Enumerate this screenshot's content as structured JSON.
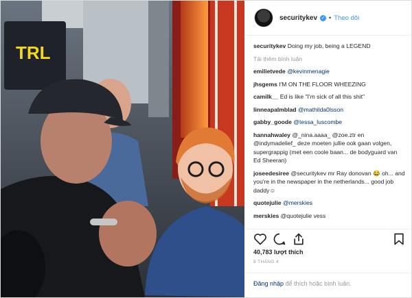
{
  "post": {
    "username": "securitykev",
    "follow_label": "Theo dõi",
    "dot": "•",
    "verified_mark": "✓",
    "caption": {
      "user": "securitykev",
      "text": "Doing my job, being a LEGEND"
    },
    "load_more": "Tải thêm bình luận",
    "comments": [
      {
        "user": "emilietvede",
        "text": "@kevinmenagie"
      },
      {
        "user": "jhsgems",
        "text": "I'M ON THE FLOOR WHEEZING"
      },
      {
        "user": "camilk__",
        "text": "Ed is like \"I'm sick of all this shit\""
      },
      {
        "user": "linneapalmblad",
        "text": "@mathilda0lsson"
      },
      {
        "user": "gabby_goode",
        "text": "@tessa_luscombe"
      },
      {
        "user": "hannahwaley",
        "text": "@_nina.aaaa_ @zoe.ztr en @indymadelief_ deze moeten jullie ook gaan volgen, supergrappig (met een coole baan... de bodyguard van Ed Sheeran)"
      },
      {
        "user": "joseedesiree",
        "text": "@securitykev mr Ray donovan 😂 oh... and you're in the newspaper in the netherlands... good job daddy☺"
      },
      {
        "user": "quotejulie",
        "text": "@merskies"
      },
      {
        "user": "merskies",
        "text": "@quotejulie vess"
      }
    ],
    "likes": "40,783 lượt thích",
    "date": "8 THÁNG 4",
    "login_link": "Đăng nhập",
    "login_rest": " để thích hoặc bình luận."
  },
  "photo": {
    "sign_text": "TRL"
  },
  "icons": [
    "heart-icon",
    "comment-icon",
    "share-icon",
    "bookmark-icon",
    "verified-icon"
  ],
  "colors": {
    "link_blue": "#3897f0",
    "mention_navy": "#003569",
    "muted": "#999999"
  }
}
